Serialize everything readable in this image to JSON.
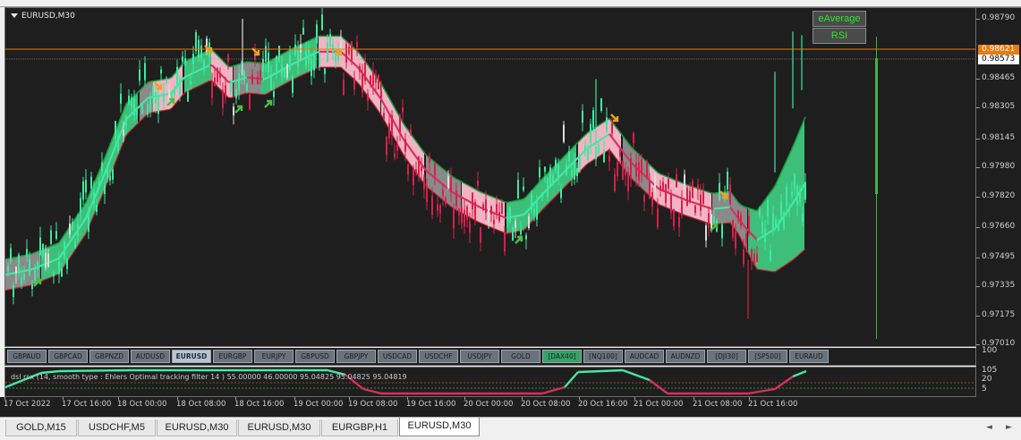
{
  "window": {
    "symbol_title": "EURUSD,M30"
  },
  "indicator_buttons": {
    "average_label": "eAverage",
    "rsi_label": "RSI"
  },
  "price_scale": {
    "ticks": [
      "0.98790",
      "0.98465",
      "0.98305",
      "0.98145",
      "0.97980",
      "0.97820",
      "0.97660",
      "0.97495",
      "0.97335",
      "0.97175",
      "0.97010"
    ],
    "tag_orange": "0.98621",
    "tag_white": "0.98573"
  },
  "symbol_bar": {
    "items": [
      "GBPAUD",
      "GBPCAD",
      "GBPNZD",
      "AUDUSD",
      "EURUSD",
      "EURGBP",
      "EURJPY",
      "GBPUSD",
      "GBPJPY",
      "USDCAD",
      "USDCHF",
      "USDJPY",
      "GOLD",
      "[DAX40]",
      "[NQ100]",
      "AUDCAD",
      "AUDNZD",
      "[DJI30]",
      "[SP500]",
      "EURAUD"
    ],
    "active": "EURUSD",
    "highlighted": "[DAX40]"
  },
  "sub_window": {
    "title": "dsl rsx (14, smooth type : Ehlers Optimal tracking filter  14 ) 55.00000 46.00000 95.04825 95.04825 95.04819",
    "scale": [
      "100",
      "105",
      "20",
      "5"
    ]
  },
  "time_axis": {
    "labels": [
      "17 Oct 2022",
      "17 Oct 16:00",
      "18 Oct 00:00",
      "18 Oct 08:00",
      "18 Oct 16:00",
      "19 Oct 00:00",
      "19 Oct 08:00",
      "19 Oct 16:00",
      "20 Oct 00:00",
      "20 Oct 08:00",
      "20 Oct 16:00",
      "21 Oct 00:00",
      "21 Oct 08:00",
      "21 Oct 16:00"
    ]
  },
  "tabs": {
    "items": [
      "GOLD,M15",
      "USDCHF,M5",
      "EURUSD,M30",
      "EURUSD,M30",
      "EURGBP,H1",
      "EURUSD,M30"
    ],
    "active_index": 5
  },
  "colors": {
    "background": "#1e1e1e",
    "bull_candle": "#3ee8a0",
    "bear_candle": "#d8204a",
    "band_green": "#3dbf7a",
    "band_pink": "#f0b4c4",
    "band_gray": "#8a8a8a",
    "orange_line": "#e87a10",
    "arrow_orange": "#f0a020",
    "arrow_green": "#4ac040"
  }
}
